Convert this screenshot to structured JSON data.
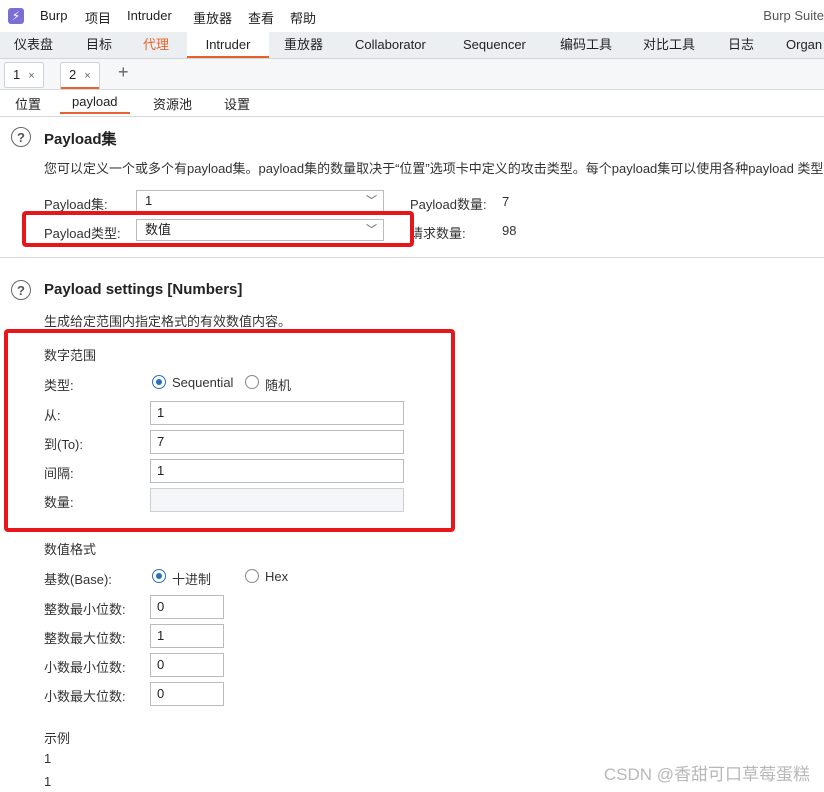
{
  "menubar": {
    "items": [
      "Burp",
      "项目",
      "Intruder",
      "重放器",
      "查看",
      "帮助"
    ],
    "app_title": "Burp Suite"
  },
  "main_tabs": [
    "仪表盘",
    "目标",
    "代理",
    "Intruder",
    "重放器",
    "Collaborator",
    "Sequencer",
    "编码工具",
    "对比工具",
    "日志",
    "Organ"
  ],
  "attack_tabs": [
    {
      "label": "1",
      "close": "×"
    },
    {
      "label": "2",
      "close": "×"
    }
  ],
  "add_tab": "+",
  "section_tabs": [
    "位置",
    "payload",
    "资源池",
    "设置"
  ],
  "payload_sets": {
    "title": "Payload集",
    "description": "您可以定义一个或多个有payload集。payload集的数量取决于“位置”选项卡中定义的攻击类型。每个payload集可以使用各种payload 类型",
    "set_label": "Payload集:",
    "set_value": "1",
    "type_label": "Payload类型:",
    "type_value": "数值",
    "count_label": "Payload数量:",
    "count_value": "7",
    "request_label": "请求数量:",
    "request_value": "98"
  },
  "payload_settings": {
    "title": "Payload settings [Numbers]",
    "description": "生成给定范围内指定格式的有效数值内容。",
    "range_heading": "数字范围",
    "type_label": "类型:",
    "type_options": [
      "Sequential",
      "随机"
    ],
    "from_label": "从:",
    "from_value": "1",
    "to_label": "到(To):",
    "to_value": "7",
    "step_label": "间隔:",
    "step_value": "1",
    "howmany_label": "数量:",
    "howmany_value": "",
    "format_heading": "数值格式",
    "base_label": "基数(Base):",
    "base_options": [
      "十进制",
      "Hex"
    ],
    "min_int_label": "整数最小位数:",
    "min_int_value": "0",
    "max_int_label": "整数最大位数:",
    "max_int_value": "1",
    "min_frac_label": "小数最小位数:",
    "min_frac_value": "0",
    "max_frac_label": "小数最大位数:",
    "max_frac_value": "0",
    "examples_heading": "示例",
    "examples": [
      "1",
      "1"
    ]
  },
  "watermark": "CSDN @香甜可口草莓蛋糕",
  "colors": {
    "accent": "#e8632a",
    "highlight": "#e6161b",
    "radio": "#2a6fbf"
  }
}
